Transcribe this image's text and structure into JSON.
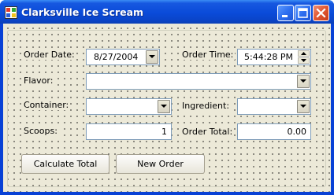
{
  "window": {
    "title": "Clarksville Ice Scream"
  },
  "form": {
    "order_date_label": "Order Date:",
    "order_date_value": "8/27/2004",
    "order_time_label": "Order Time:",
    "order_time_value": "5:44:28 PM",
    "flavor_label": "Flavor:",
    "flavor_value": "",
    "container_label": "Container:",
    "container_value": "",
    "ingredient_label": "Ingredient:",
    "ingredient_value": "",
    "scoops_label": "Scoops:",
    "scoops_value": "1",
    "order_total_label": "Order Total:",
    "order_total_value": "0.00"
  },
  "buttons": {
    "calculate_label": "Calculate Total",
    "new_order_label": "New Order"
  },
  "colors": {
    "titlebar": "#0a4bd9",
    "form_background": "#ece9d8",
    "close_button": "#e35a34"
  }
}
